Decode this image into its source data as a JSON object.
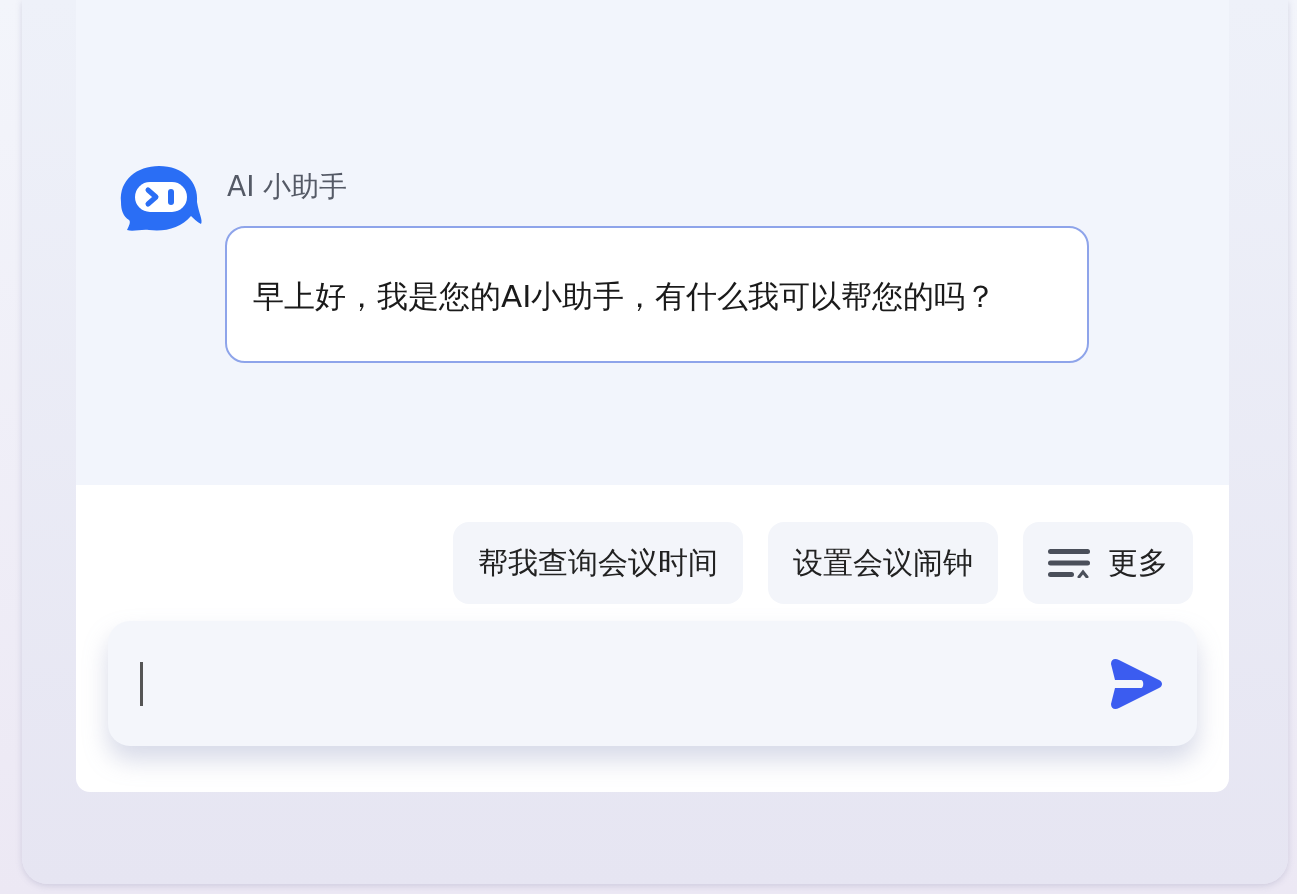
{
  "assistant": {
    "name": "AI 小助手"
  },
  "messages": [
    {
      "text": "早上好，我是您的AI小助手，有什么我可以帮您的吗？"
    }
  ],
  "suggestions": [
    {
      "label": "帮我查询会议时间"
    },
    {
      "label": "设置会议闹钟"
    }
  ],
  "more_button": {
    "label": "更多"
  }
}
